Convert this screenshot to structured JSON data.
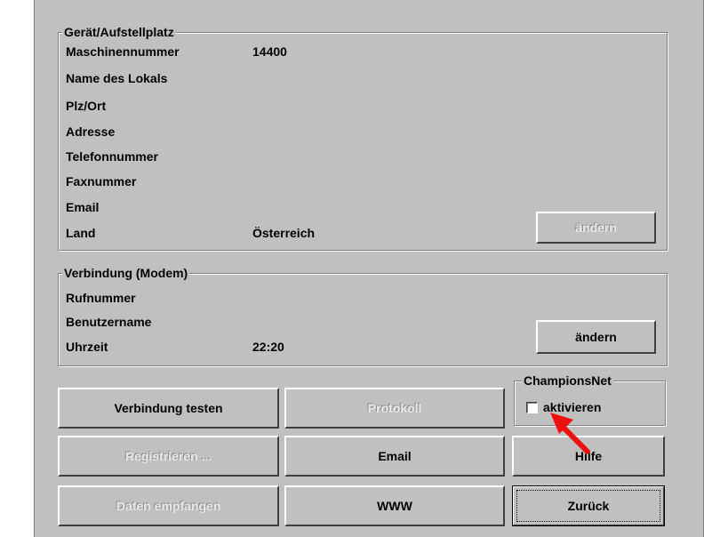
{
  "geraet": {
    "legend": "Gerät/Aufstellplatz",
    "rows": [
      {
        "label": "Maschinennummer",
        "value": "14400"
      },
      {
        "label": "Name des Lokals",
        "value": ""
      },
      {
        "label": "Plz/Ort",
        "value": ""
      },
      {
        "label": "Adresse",
        "value": ""
      },
      {
        "label": "Telefonnummer",
        "value": ""
      },
      {
        "label": "Faxnummer",
        "value": ""
      },
      {
        "label": "Email",
        "value": ""
      },
      {
        "label": "Land",
        "value": "Österreich"
      }
    ],
    "change_label": "ändern"
  },
  "verbindung": {
    "legend": "Verbindung (Modem)",
    "rows": [
      {
        "label": "Rufnummer",
        "value": ""
      },
      {
        "label": "Benutzername",
        "value": ""
      },
      {
        "label": "Uhrzeit",
        "value": "22:20"
      }
    ],
    "change_label": "ändern"
  },
  "championsnet": {
    "legend": "ChampionsNet",
    "checkbox_label": "aktivieren",
    "checked": false
  },
  "buttons": {
    "verbindung_testen": "Verbindung testen",
    "protokoll": "Protokoll",
    "registrieren": "Registrieren ...",
    "email": "Email",
    "hilfe": "Hilfe",
    "daten_empfangen": "Daten empfangen",
    "www": "WWW",
    "zurueck": "Zurück"
  },
  "colors": {
    "panel": "#c0c0c0",
    "annotation_arrow": "#ee1111"
  }
}
